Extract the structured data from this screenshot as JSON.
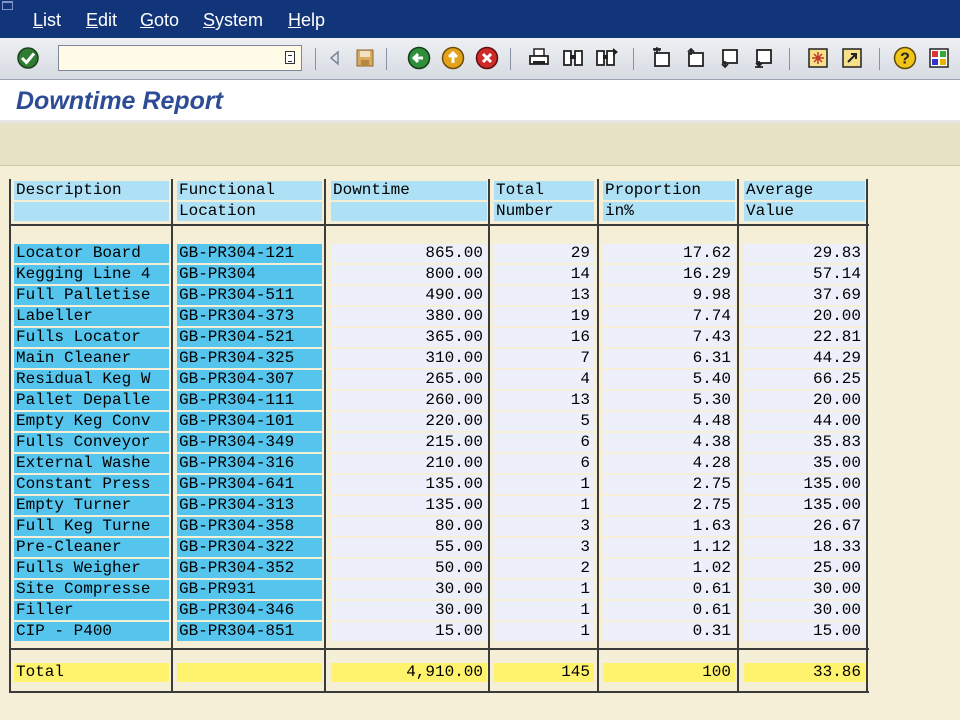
{
  "menu": {
    "items": [
      "List",
      "Edit",
      "Goto",
      "System",
      "Help"
    ]
  },
  "toolbar": {
    "command_value": ""
  },
  "page": {
    "title": "Downtime Report"
  },
  "table": {
    "headers": [
      [
        "Description",
        ""
      ],
      [
        "Functional",
        "Location"
      ],
      [
        "Downtime",
        ""
      ],
      [
        "Total",
        "Number"
      ],
      [
        "Proportion",
        "in%"
      ],
      [
        "Average",
        "Value"
      ]
    ],
    "rows": [
      {
        "description": "Locator Board",
        "location": "GB-PR304-121",
        "downtime": "865.00",
        "number": "29",
        "proportion": "17.62",
        "average": "29.83"
      },
      {
        "description": "Kegging Line 4",
        "location": "GB-PR304",
        "downtime": "800.00",
        "number": "14",
        "proportion": "16.29",
        "average": "57.14"
      },
      {
        "description": "Full Palletise",
        "location": "GB-PR304-511",
        "downtime": "490.00",
        "number": "13",
        "proportion": "9.98",
        "average": "37.69"
      },
      {
        "description": "Labeller",
        "location": "GB-PR304-373",
        "downtime": "380.00",
        "number": "19",
        "proportion": "7.74",
        "average": "20.00"
      },
      {
        "description": "Fulls Locator",
        "location": "GB-PR304-521",
        "downtime": "365.00",
        "number": "16",
        "proportion": "7.43",
        "average": "22.81"
      },
      {
        "description": "Main Cleaner",
        "location": "GB-PR304-325",
        "downtime": "310.00",
        "number": "7",
        "proportion": "6.31",
        "average": "44.29"
      },
      {
        "description": "Residual Keg W",
        "location": "GB-PR304-307",
        "downtime": "265.00",
        "number": "4",
        "proportion": "5.40",
        "average": "66.25"
      },
      {
        "description": "Pallet Depalle",
        "location": "GB-PR304-111",
        "downtime": "260.00",
        "number": "13",
        "proportion": "5.30",
        "average": "20.00"
      },
      {
        "description": "Empty Keg Conv",
        "location": "GB-PR304-101",
        "downtime": "220.00",
        "number": "5",
        "proportion": "4.48",
        "average": "44.00"
      },
      {
        "description": "Fulls Conveyor",
        "location": "GB-PR304-349",
        "downtime": "215.00",
        "number": "6",
        "proportion": "4.38",
        "average": "35.83"
      },
      {
        "description": "External Washe",
        "location": "GB-PR304-316",
        "downtime": "210.00",
        "number": "6",
        "proportion": "4.28",
        "average": "35.00"
      },
      {
        "description": "Constant Press",
        "location": "GB-PR304-641",
        "downtime": "135.00",
        "number": "1",
        "proportion": "2.75",
        "average": "135.00"
      },
      {
        "description": "Empty Turner",
        "location": "GB-PR304-313",
        "downtime": "135.00",
        "number": "1",
        "proportion": "2.75",
        "average": "135.00"
      },
      {
        "description": "Full Keg Turne",
        "location": "GB-PR304-358",
        "downtime": "80.00",
        "number": "3",
        "proportion": "1.63",
        "average": "26.67"
      },
      {
        "description": "Pre-Cleaner",
        "location": "GB-PR304-322",
        "downtime": "55.00",
        "number": "3",
        "proportion": "1.12",
        "average": "18.33"
      },
      {
        "description": "Fulls Weigher",
        "location": "GB-PR304-352",
        "downtime": "50.00",
        "number": "2",
        "proportion": "1.02",
        "average": "25.00"
      },
      {
        "description": "Site Compresse",
        "location": "GB-PR931",
        "downtime": "30.00",
        "number": "1",
        "proportion": "0.61",
        "average": "30.00"
      },
      {
        "description": "Filler",
        "location": "GB-PR304-346",
        "downtime": "30.00",
        "number": "1",
        "proportion": "0.61",
        "average": "30.00"
      },
      {
        "description": "CIP - P400",
        "location": "GB-PR304-851",
        "downtime": "15.00",
        "number": "1",
        "proportion": "0.31",
        "average": "15.00"
      }
    ],
    "total": {
      "description": "Total",
      "location": "",
      "downtime": "4,910.00",
      "number": "145",
      "proportion": "100",
      "average": "33.86"
    }
  },
  "colors": {
    "menubar": "#123478",
    "title": "#2d4c95",
    "header_cell": "#aee1f6",
    "key_cell": "#55c5ee",
    "value_cell": "#edf0fb",
    "total_cell": "#fff36e",
    "background": "#f4efd6"
  },
  "icons": [
    "enter-check-icon",
    "history-icon",
    "previous-icon",
    "save-icon",
    "back-icon",
    "exit-icon",
    "cancel-icon",
    "print-icon",
    "find-icon",
    "find-next-icon",
    "first-page-icon",
    "previous-page-icon",
    "next-page-icon",
    "last-page-icon",
    "new-session-icon",
    "shortcut-icon",
    "help-icon",
    "layout-icon"
  ]
}
